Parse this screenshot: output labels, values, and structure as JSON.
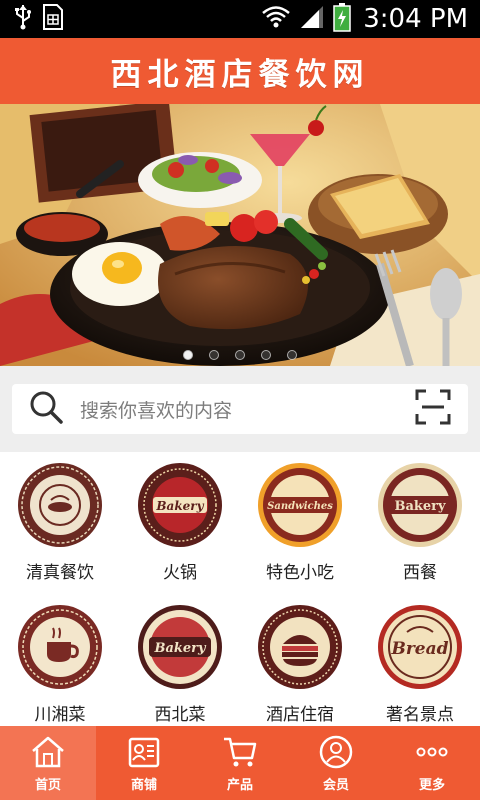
{
  "status_bar": {
    "time": "3:04 PM",
    "left_icons": [
      "usb-icon",
      "sim-card-icon"
    ],
    "right_icons": [
      "wifi-icon",
      "signal-icon",
      "battery-charging-icon"
    ]
  },
  "header": {
    "title": "西北酒店餐饮网",
    "background_color": "#ef5a33"
  },
  "banner": {
    "image": "steak-dinner-photo",
    "slide_count": 5,
    "active_slide": 1
  },
  "search": {
    "placeholder": "搜索你喜欢的内容",
    "left_icon": "search-icon",
    "right_icon": "scan-icon"
  },
  "categories": [
    {
      "label": "清真餐饮",
      "badge_icon": "premium-quality-badge-icon"
    },
    {
      "label": "火锅",
      "badge_icon": "bakery-badge-icon",
      "badge_text": "Bakery"
    },
    {
      "label": "特色小吃",
      "badge_icon": "sandwiches-badge-icon",
      "badge_text": "Sandwiches"
    },
    {
      "label": "西餐",
      "badge_icon": "bakery-badge-icon",
      "badge_text": "Bakery"
    },
    {
      "label": "川湘菜",
      "badge_icon": "coffee-cup-badge-icon"
    },
    {
      "label": "西北菜",
      "badge_icon": "cafe-bistro-bakery-badge-icon",
      "badge_text": "Bakery"
    },
    {
      "label": "酒店住宿",
      "badge_icon": "burger-badge-icon"
    },
    {
      "label": "著名景点",
      "badge_icon": "bread-badge-icon",
      "badge_text": "Bread"
    }
  ],
  "bottom_nav": {
    "active_index": 0,
    "items": [
      {
        "label": "首页",
        "icon": "home-icon"
      },
      {
        "label": "商铺",
        "icon": "store-card-icon"
      },
      {
        "label": "产品",
        "icon": "cart-icon"
      },
      {
        "label": "会员",
        "icon": "member-icon"
      },
      {
        "label": "更多",
        "icon": "more-icon"
      }
    ]
  },
  "colors": {
    "brand": "#ef5a33",
    "nav_active": "#f37453",
    "search_bg": "#eeeeee"
  }
}
